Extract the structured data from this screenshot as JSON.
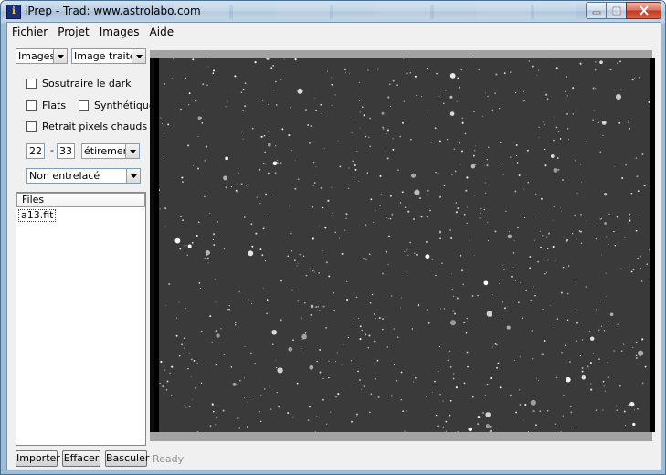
{
  "window": {
    "title": "iPrep - Trad: www.astrolabo.com",
    "icon": "telescope-app-icon",
    "icon_glyph": "i"
  },
  "menu": [
    "Fichier",
    "Projet",
    "Images",
    "Aide"
  ],
  "controls": {
    "source_select": "Images",
    "view_select": "Image traitée",
    "subtract_dark": "Sosutraire le dark",
    "flats": "Flats",
    "synthetic": "Synthétique",
    "hot_pixels": "Retrait pixels chauds",
    "range_low": "22",
    "range_sep": "-",
    "range_high": "33",
    "stretch_select": "étirement l",
    "interlace_select": "Non entrelacé"
  },
  "files": {
    "header": "Files",
    "items": [
      "a13.fit"
    ]
  },
  "buttons": {
    "import": "Importer",
    "clear": "Effacer",
    "toggle": "Basculer"
  },
  "status": "Ready",
  "colors": {
    "sky_background": "#3a3a3a",
    "viewer_frame": "#a3a3a3",
    "close_button": "#c2381e"
  }
}
